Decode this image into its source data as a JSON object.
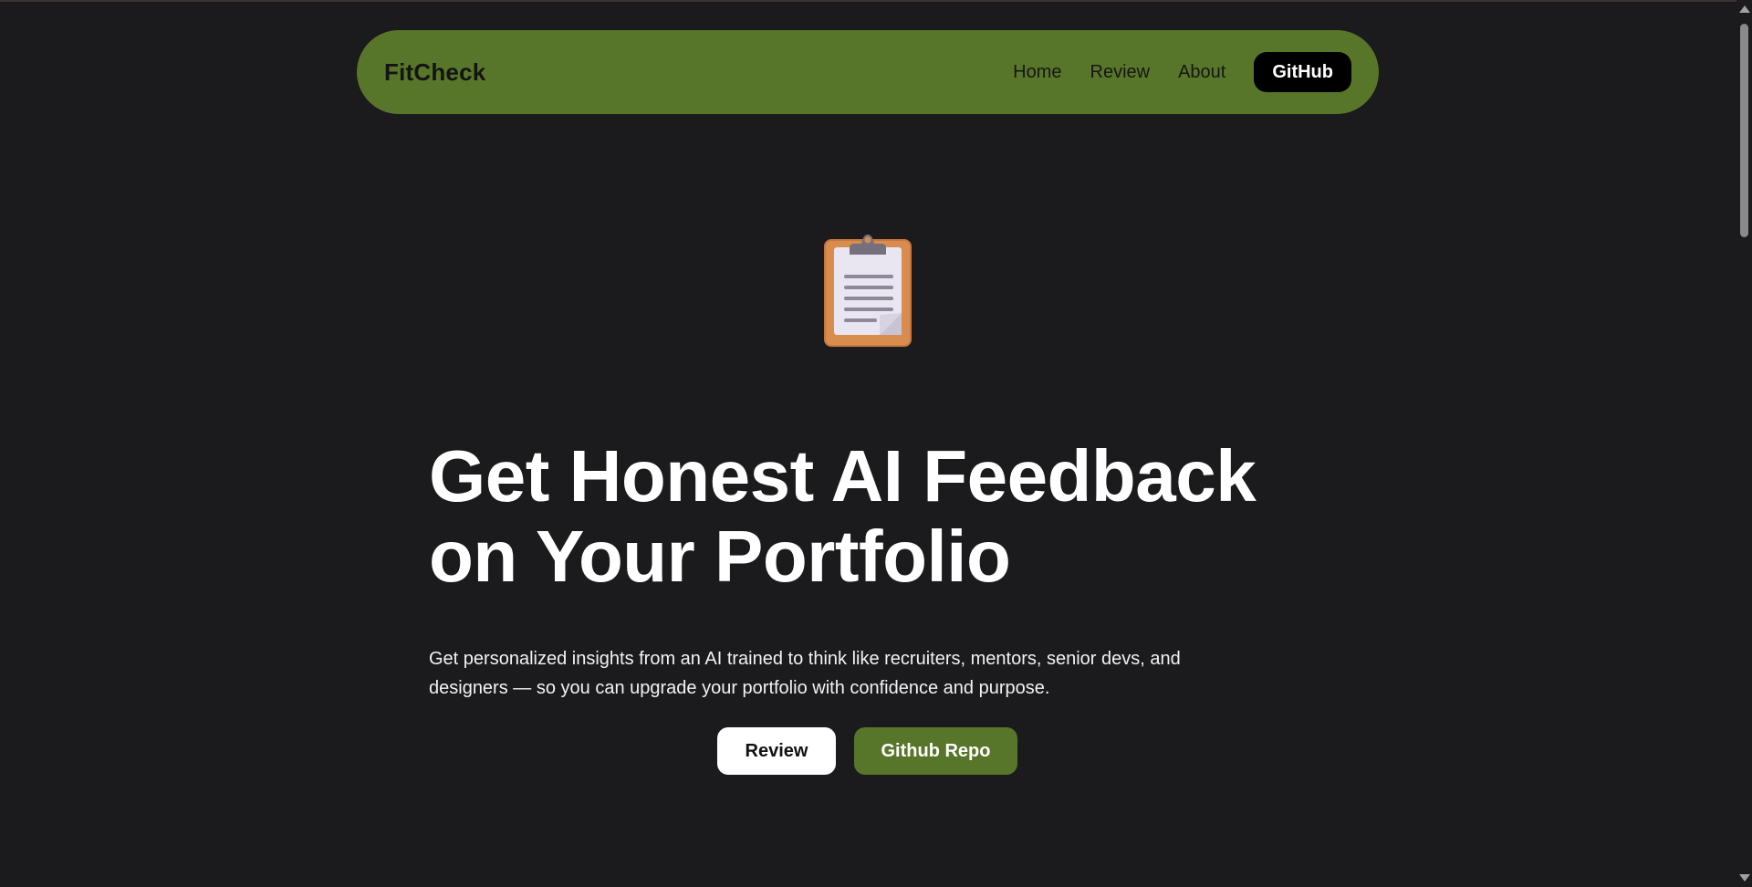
{
  "nav": {
    "brand": "FitCheck",
    "links": [
      "Home",
      "Review",
      "About"
    ],
    "github_label": "GitHub"
  },
  "hero": {
    "icon": "clipboard-icon",
    "title_line1": "Get Honest AI Feedback",
    "title_line2": "on Your Portfolio",
    "subtitle": "Get personalized insights from an AI trained to think like recruiters, mentors, senior devs, and designers — so you can upgrade your portfolio with confidence and purpose.",
    "review_button": "Review",
    "repo_button": "Github Repo"
  },
  "colors": {
    "background": "#1b1a1d",
    "accent_green": "#577629",
    "white": "#ffffff",
    "black": "#000000"
  }
}
